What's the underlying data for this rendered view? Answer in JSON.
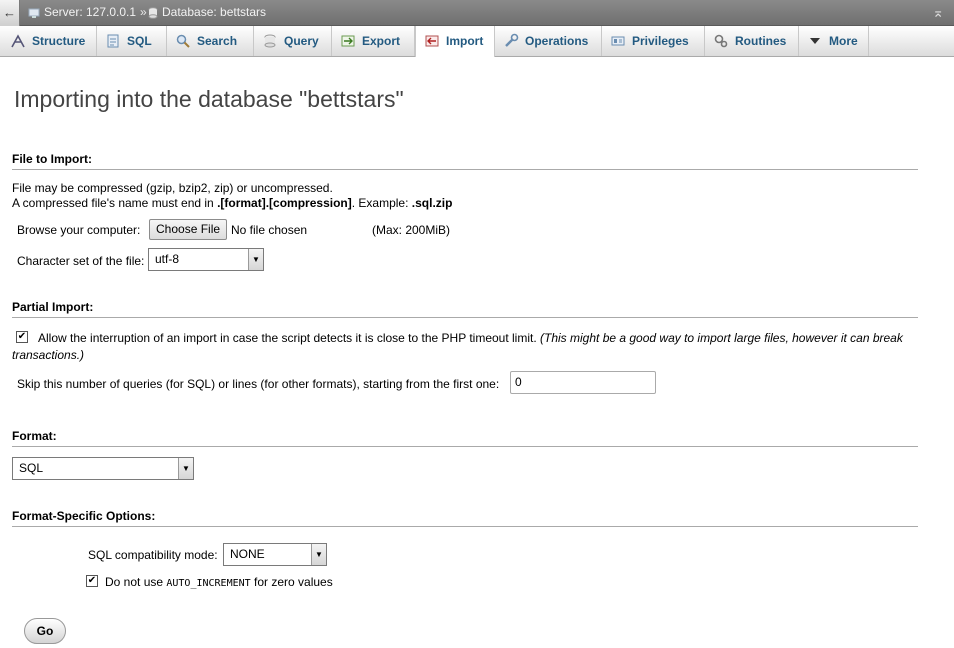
{
  "breadcrumb": {
    "back_glyph": "←",
    "server_label": "Server: 127.0.0.1",
    "separator": "»",
    "database_label": "Database: bettstars",
    "collapse_glyph": "⌅"
  },
  "tabs": [
    {
      "label": "Structure",
      "icon": "structure-icon"
    },
    {
      "label": "SQL",
      "icon": "sql-icon"
    },
    {
      "label": "Search",
      "icon": "search-icon"
    },
    {
      "label": "Query",
      "icon": "query-icon"
    },
    {
      "label": "Export",
      "icon": "export-icon"
    },
    {
      "label": "Import",
      "icon": "import-icon",
      "active": true
    },
    {
      "label": "Operations",
      "icon": "operations-icon"
    },
    {
      "label": "Privileges",
      "icon": "privileges-icon"
    },
    {
      "label": "Routines",
      "icon": "routines-icon"
    },
    {
      "label": "More",
      "icon": "dropdown-arrow-icon"
    }
  ],
  "page_title": "Importing into the database \"bettstars\"",
  "file_section": {
    "heading": "File to Import:",
    "note_line1": "File may be compressed (gzip, bzip2, zip) or uncompressed.",
    "note_line2_prefix": "A compressed file's name must end in ",
    "note_line2_format": ".[format].[compression]",
    "note_line2_mid": ". Example: ",
    "note_line2_example": ".sql.zip",
    "browse_label": "Browse your computer:",
    "choose_file_button": "Choose File",
    "no_file_text": "No file chosen",
    "max_size": "(Max: 200MiB)",
    "charset_label": "Character set of the file:",
    "charset_value": "utf-8"
  },
  "partial_section": {
    "heading": "Partial Import:",
    "allow_interrupt_checked": true,
    "allow_interrupt_text": "Allow the interruption of an import in case the script detects it is close to the PHP timeout limit.",
    "allow_interrupt_note_1": "(This might be a good way to import large files, however it can break",
    "allow_interrupt_note_2": "transactions.)",
    "skip_label": "Skip this number of queries (for SQL) or lines (for other formats), starting from the first one:",
    "skip_value": "0"
  },
  "format_section": {
    "heading": "Format:",
    "format_value": "SQL"
  },
  "options_section": {
    "heading": "Format-Specific Options:",
    "compat_label": "SQL compatibility mode:",
    "compat_value": "NONE",
    "auto_inc_checked": true,
    "auto_inc_prefix": "Do not use ",
    "auto_inc_code": "AUTO_INCREMENT",
    "auto_inc_suffix": " for zero values"
  },
  "go_button": "Go",
  "colors": {
    "tab_text": "#235a81",
    "title_bar": "#7c7c7c",
    "heading_rule": "#aaaaaa"
  }
}
